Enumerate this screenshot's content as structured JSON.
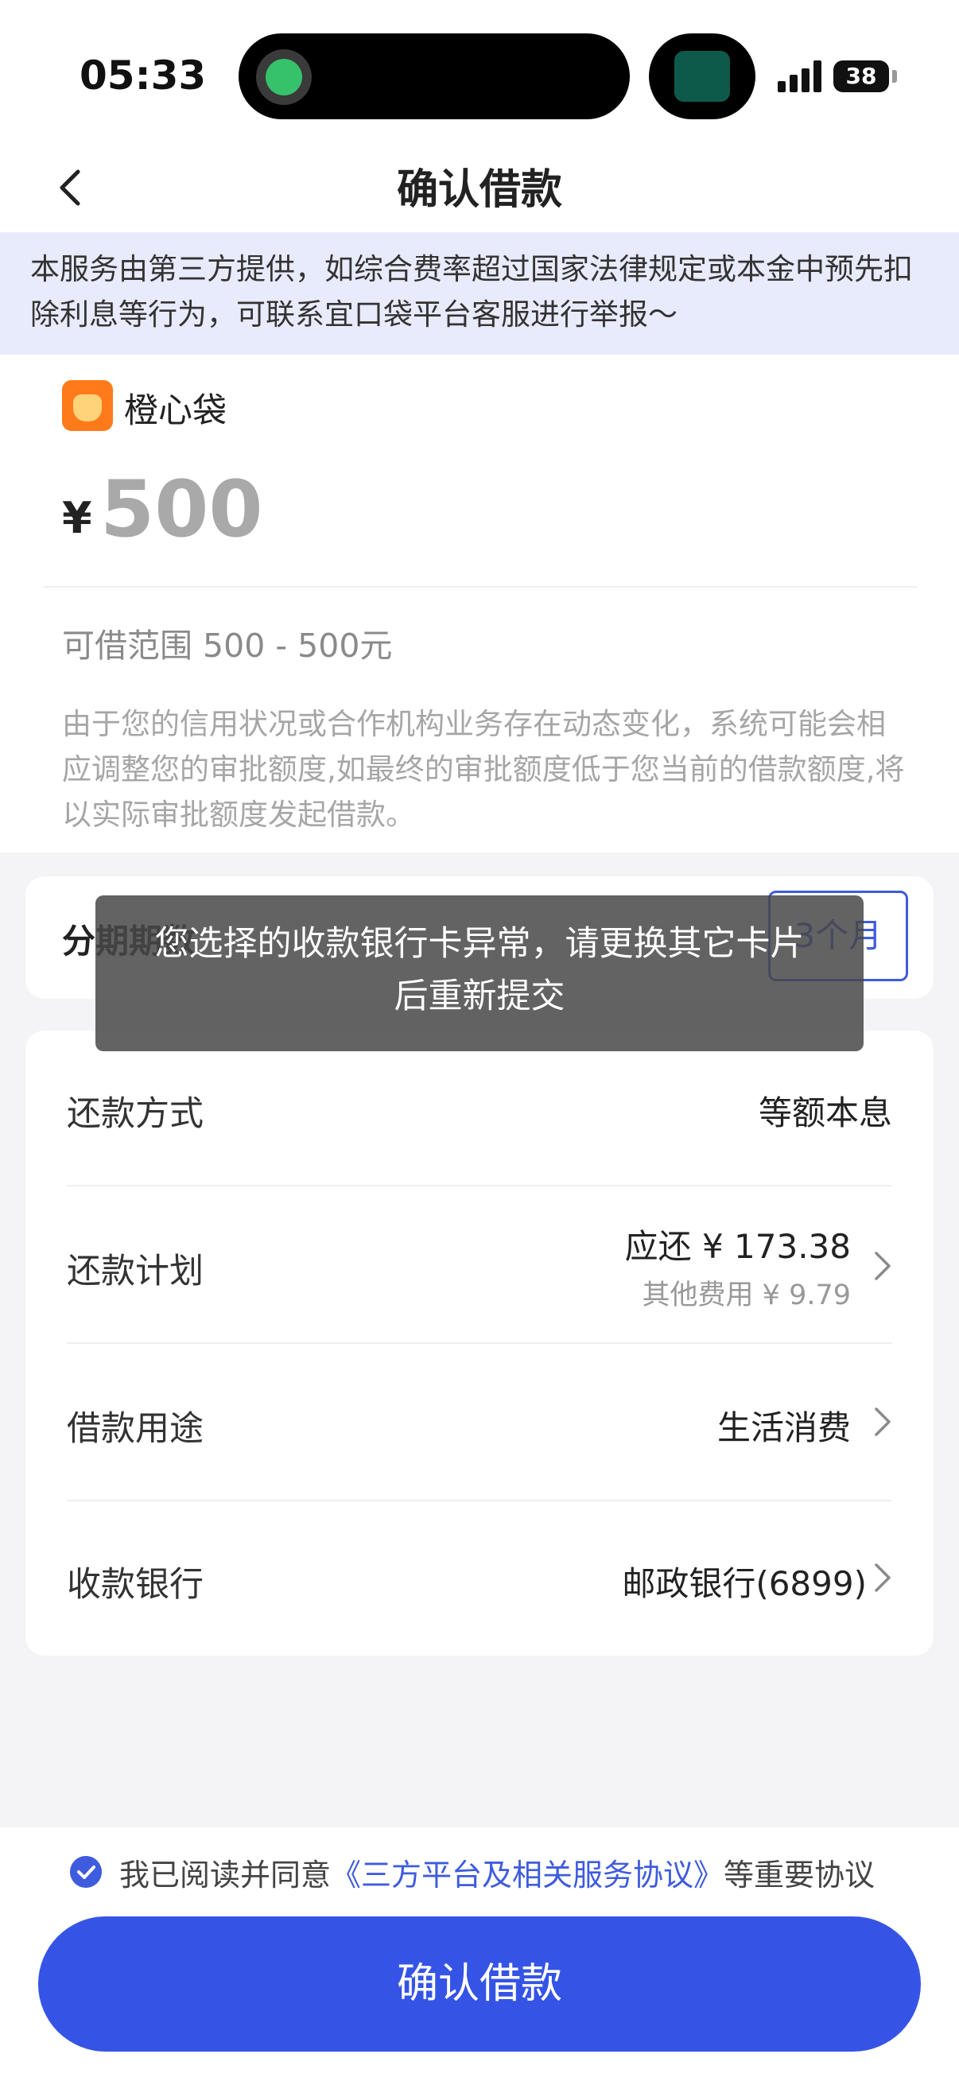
{
  "status_bar": {
    "time": "05:33",
    "battery": "38"
  },
  "header": {
    "title": "确认借款"
  },
  "notice": {
    "text": "本服务由第三方提供，如综合费率超过国家法律规定或本金中预先扣除利息等行为，可联系宜口袋平台客服进行举报～"
  },
  "loan": {
    "lender_name": "橙心袋",
    "currency": "¥",
    "amount": "500",
    "range_text": "可借范围 500 - 500元",
    "disclaimer": "由于您的信用状况或合作机构业务存在动态变化，系统可能会相应调整您的审批额度,如最终的审批额度低于您当前的借款额度,将以实际审批额度发起借款。"
  },
  "installment": {
    "label": "分期期数",
    "selected_option": "3个月"
  },
  "details": {
    "repayment_method": {
      "label": "还款方式",
      "value": "等额本息"
    },
    "repayment_plan": {
      "label": "还款计划",
      "due": "应还 ¥ 173.38",
      "fees": "其他费用 ¥ 9.79"
    },
    "loan_purpose": {
      "label": "借款用途",
      "value": "生活消费"
    },
    "receiving_bank": {
      "label": "收款银行",
      "value": "邮政银行(6899)"
    }
  },
  "agreement": {
    "prefix": "我已阅读并同意",
    "link": "《三方平台及相关服务协议》",
    "suffix": "等重要协议",
    "checked": true
  },
  "confirm_button": {
    "label": "确认借款"
  },
  "toast": {
    "line1": "您选择的收款银行卡异常，请更换其它卡片",
    "line2": "后重新提交"
  },
  "colors": {
    "primary": "#3554e6",
    "notice_bg": "#e8ebfb",
    "brand_orange": "#ff7a1a"
  }
}
